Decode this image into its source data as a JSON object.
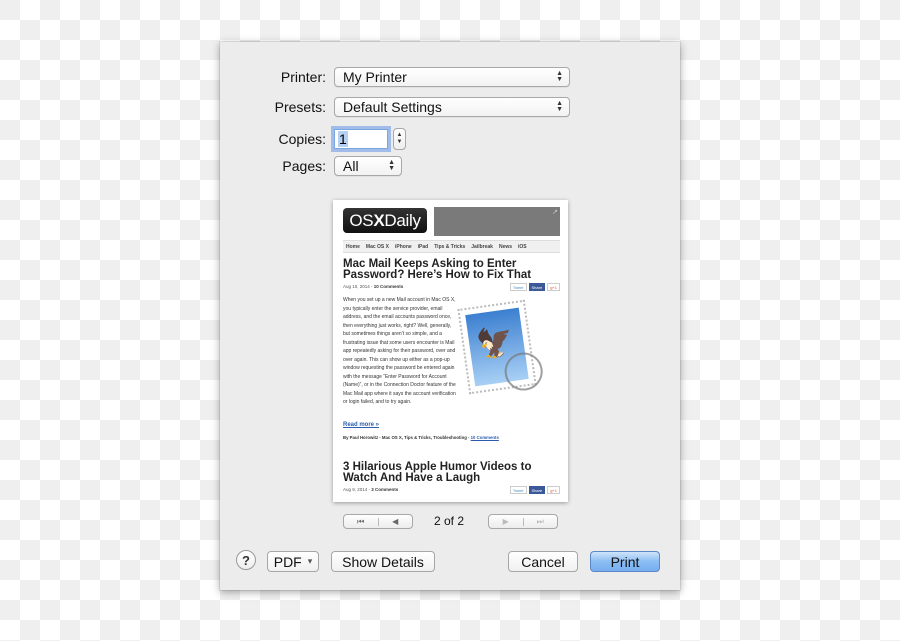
{
  "dialog": {
    "printer": {
      "label": "Printer:",
      "value": "My Printer"
    },
    "presets": {
      "label": "Presets:",
      "value": "Default Settings"
    },
    "copies": {
      "label": "Copies:",
      "value": "1"
    },
    "pages": {
      "label": "Pages:",
      "value": "All"
    }
  },
  "preview": {
    "logo": {
      "part1": "OS",
      "part2": "X",
      "part3": "Daily"
    },
    "ad_icon": "↗",
    "nav": [
      "Home",
      "Mac OS X",
      "iPhone",
      "iPad",
      "Tips & Tricks",
      "Jailbreak",
      "News",
      "iOS"
    ],
    "article1": {
      "title": "Mac Mail Keeps Asking to Enter Password? Here’s How to Fix That",
      "date": "Aug 10, 2014 - ",
      "comments": "10 Comments",
      "body": "When you set up a new Mail account in Mac OS X, you typically enter the service provider, email address, and the email accounts password once, then everything just works, right? Well, generally, but sometimes things aren’t so simple, and a frustrating issue that some users encounter is Mail app repeatedly asking for their password, over and over again. This can show up either as a pop-up window requesting the password be entered again with the message “Enter Password for Account (Name)”, or in the Connection Doctor feature of the Mac Mail app where it says the account verification or login failed, and to try again.",
      "read_more": "Read more »",
      "byline": "By Paul Horowitz - Mac OS X, Tips & Tricks, Troubleshooting - ",
      "byline_link": "10 Comments"
    },
    "article2": {
      "title": "3 Hilarious Apple Humor Videos to Watch And Have a Laugh",
      "date": "Aug 9, 2014 - ",
      "comments": "3 Comments"
    },
    "social": {
      "tweet": "Tweet",
      "share": "Share",
      "gplus": "g+1"
    }
  },
  "pager": {
    "first": "⏮",
    "prev": "◀",
    "next": "▶",
    "last": "⏭",
    "current": "2",
    "of_label": "of",
    "total": "2",
    "text": "2 of 2"
  },
  "footer": {
    "help": "?",
    "pdf": "PDF",
    "pdf_arrow": "▾",
    "show_details": "Show Details",
    "cancel": "Cancel",
    "print": "Print"
  }
}
